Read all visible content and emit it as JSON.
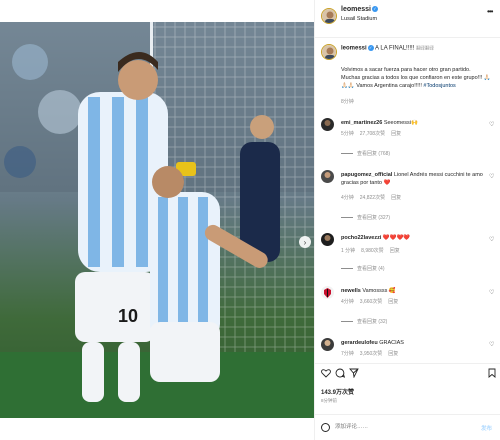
{
  "post": {
    "username": "leomessi",
    "location": "Lusail Stadium",
    "more_icon": "more-horizontal-icon"
  },
  "caption": {
    "username": "leomessi",
    "headline": "A LA FINAL!!!!!",
    "translate_label": "翻译翻译",
    "body": "Volvimos a sacar fuerza para hacer otro gran partido. Muchas gracias a todos los que confiaron en este grupo!!! 🙏🏻🙏🏻🙏🏻 Vamos Argentina carajo!!!!! ",
    "hashtag": "#Todosjuntos",
    "time": "8分钟"
  },
  "comments": [
    {
      "username": "emi_martinez26",
      "text": "Seeomessi🙌",
      "time": "5分钟",
      "likes": "27,708次赞",
      "reply": "回复",
      "view_replies": "查看回复 (768)"
    },
    {
      "username": "papugomez_official",
      "text": "Lionel Andrés messi cucchini te amo gracias por tanto ❤️",
      "time": "4分钟",
      "likes": "24,822次赞",
      "reply": "回复",
      "view_replies": "查看回复 (327)"
    },
    {
      "username": "pocho22lavezzi",
      "text": "❤️❤️❤️❤️",
      "time": "1 分钟",
      "likes": "8,980次赞",
      "reply": "回复",
      "view_replies": "查看回复 (4)"
    },
    {
      "username": "newells",
      "text": "Vamossss 🥰",
      "time": "4分钟",
      "likes": "3,660次赞",
      "reply": "回复",
      "view_replies": "查看回复 (32)"
    },
    {
      "username": "gerardeulofeu",
      "text": "GRACIAS",
      "time": "7分钟",
      "likes": "3,950次赞",
      "reply": "回复",
      "view_replies": ""
    }
  ],
  "stats": {
    "likes": "143.9万次赞",
    "date": "8分钟前"
  },
  "composer": {
    "placeholder": "添加评论……",
    "post_label": "发布"
  },
  "colors": {
    "link": "#00376b",
    "muted": "#8e8e8e",
    "verified": "#3897f0",
    "post_button_disabled": "#b3dbff",
    "carousel_active_dot": "#4aa3ff"
  },
  "carousel": {
    "slides": 10,
    "active_index": 0
  }
}
